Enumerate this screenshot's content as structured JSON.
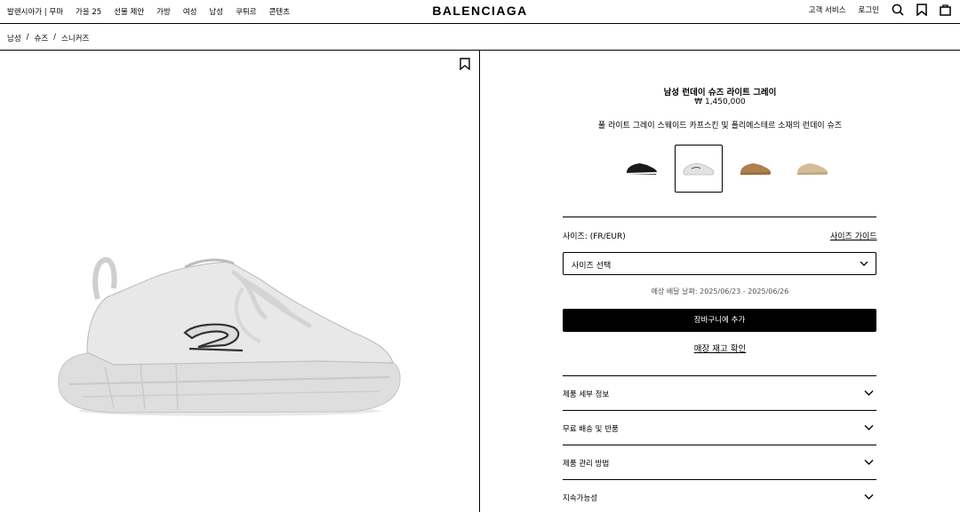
{
  "nav": {
    "left_items": [
      "발렌시아가 | 무마",
      "가을 25",
      "선물 제안",
      "가방",
      "여성",
      "남성",
      "쿠튀르",
      "콘텐츠"
    ],
    "logo": "BALENCIAGA",
    "customer_service": "고객 서비스",
    "login": "로그인",
    "icons": [
      "search-icon",
      "bookmark-icon",
      "cart-icon"
    ]
  },
  "breadcrumb": [
    "남성",
    "슈즈",
    "스니커즈"
  ],
  "product": {
    "title": "남성 런데이 슈즈 라이트 그레이",
    "price": "₩ 1,450,000",
    "description": "풀 라이트 그레이 스웨이드 카프스킨 및 폴리에스테르 소재의 런데이 슈즈",
    "thumbnails": [
      {
        "color": "black",
        "hex": "#1a1a1a",
        "selected": false
      },
      {
        "color": "light-gray",
        "hex": "#e6e6e6",
        "selected": true
      },
      {
        "color": "tan",
        "hex": "#b07f4e",
        "selected": false
      },
      {
        "color": "beige",
        "hex": "#d2bd98",
        "selected": false
      }
    ]
  },
  "size": {
    "label": "사이즈: (FR/EUR)",
    "guide": "사이즈 가이드",
    "select_placeholder": "사이즈 선택"
  },
  "delivery": "예상 배달 날짜: 2025/06/23 - 2025/06/26",
  "cart_button": "장바구니에 추가",
  "stock_link": "매장 재고 확인",
  "accordion": [
    "제품 세부 정보",
    "무료 배송 및 반품",
    "제품 관리 방법",
    "지속가능성"
  ]
}
